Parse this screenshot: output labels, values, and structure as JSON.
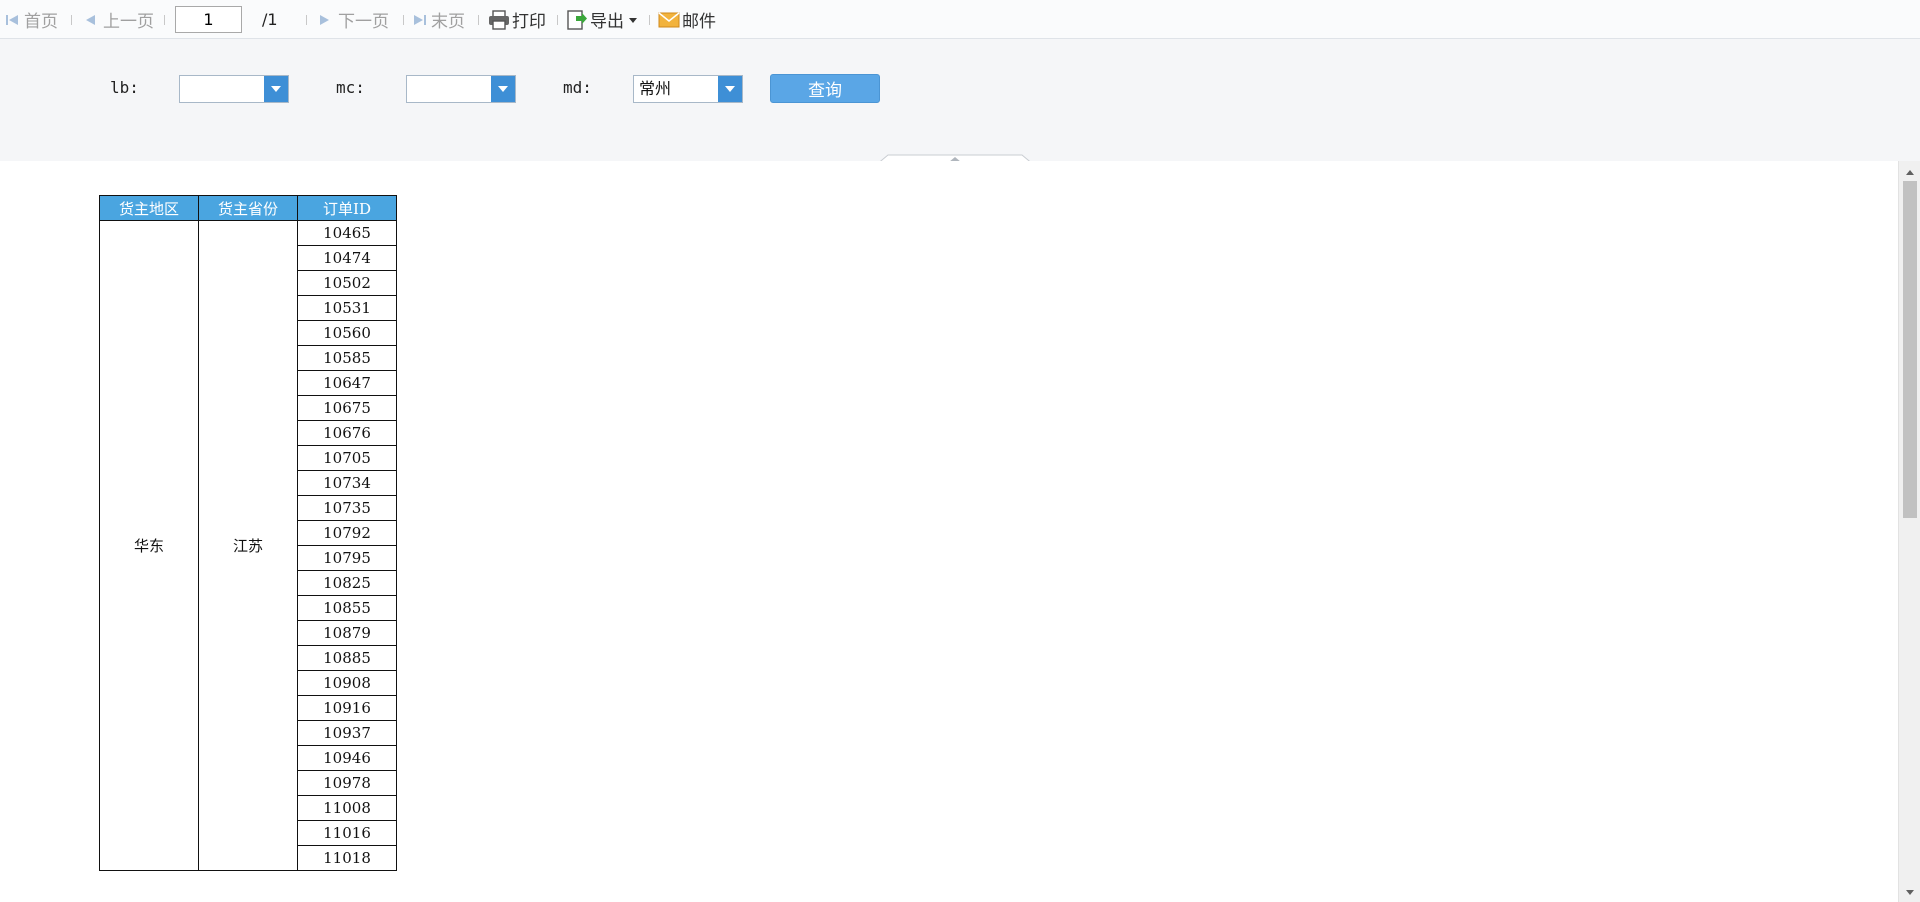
{
  "toolbar": {
    "first_label": "首页",
    "prev_label": "上一页",
    "page_value": "1",
    "page_total": "/1",
    "next_label": "下一页",
    "last_label": "末页",
    "print_label": "打印",
    "export_label": "导出",
    "mail_label": "邮件"
  },
  "params": {
    "lb_label": "lb:",
    "lb_value": "",
    "mc_label": "mc:",
    "mc_value": "",
    "md_label": "md:",
    "md_value": "常州",
    "query_label": "查询"
  },
  "table": {
    "headers": [
      "货主地区",
      "货主省份",
      "订单ID"
    ],
    "region": "华东",
    "province": "江苏",
    "order_ids": [
      "10465",
      "10474",
      "10502",
      "10531",
      "10560",
      "10585",
      "10647",
      "10675",
      "10676",
      "10705",
      "10734",
      "10735",
      "10792",
      "10795",
      "10825",
      "10855",
      "10879",
      "10885",
      "10908",
      "10916",
      "10937",
      "10946",
      "10978",
      "11008",
      "11016",
      "11018"
    ]
  },
  "colors": {
    "header_bg": "#4aa5e0",
    "query_button": "#5aa6e6",
    "combo_button": "#3e8fd6"
  }
}
